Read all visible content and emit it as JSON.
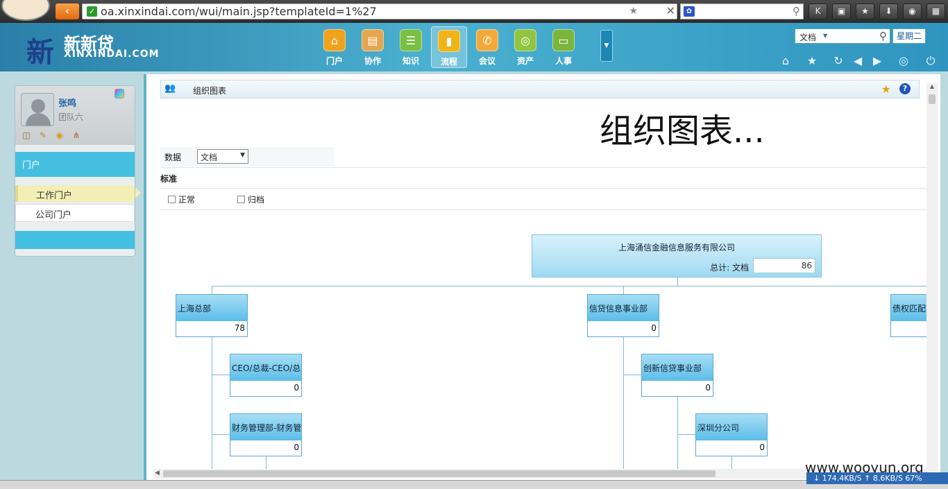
{
  "browser": {
    "url": "oa.xinxindai.com/wui/main.jsp?templateId=1%27",
    "back_glyph": "‹",
    "check_glyph": "✓",
    "star_glyph": "★",
    "close_glyph": "✕",
    "search_glyph": "⚲",
    "engine_glyph": "✿",
    "toolbar": [
      {
        "name": "k-button",
        "glyph": "K"
      },
      {
        "name": "lock-icon",
        "glyph": "▣"
      },
      {
        "name": "star-icon",
        "glyph": "★"
      },
      {
        "name": "download-icon",
        "glyph": "⬇"
      },
      {
        "name": "gamepad-icon",
        "glyph": "◉"
      },
      {
        "name": "grid-icon",
        "glyph": "▦"
      }
    ]
  },
  "header": {
    "logo_mark": "新",
    "logo_cn": "新新贷",
    "logo_en": "XINXINDAI.COM",
    "nav": [
      {
        "label": "门户",
        "icon": "home-icon",
        "glyph": "⌂",
        "color": "#f0a21c"
      },
      {
        "label": "协作",
        "icon": "clipboard-icon",
        "glyph": "▤",
        "color": "#e6a64f"
      },
      {
        "label": "知识",
        "icon": "database-icon",
        "glyph": "☰",
        "color": "#7bbf42"
      },
      {
        "label": "流程",
        "icon": "bar-chart-icon",
        "glyph": "▮",
        "color": "#f0b419"
      },
      {
        "label": "会议",
        "icon": "phone-icon",
        "glyph": "✆",
        "color": "#f2a93a"
      },
      {
        "label": "资产",
        "icon": "coins-icon",
        "glyph": "◎",
        "color": "#8fc63f"
      },
      {
        "label": "人事",
        "icon": "window-icon",
        "glyph": "▭",
        "color": "#7ab63b"
      }
    ],
    "active_nav": "流程",
    "search_type": "文档",
    "weekday": "星期二",
    "tools": [
      {
        "name": "home-tool-icon",
        "glyph": "⌂"
      },
      {
        "name": "favorite-tool-icon",
        "glyph": "★"
      },
      {
        "name": "refresh-tool-icon",
        "glyph": "↻"
      },
      {
        "name": "back-tool-icon",
        "glyph": "◀"
      },
      {
        "name": "forward-tool-icon",
        "glyph": "▶"
      },
      {
        "name": "settings-tool-icon",
        "glyph": "◎"
      },
      {
        "name": "power-tool-icon",
        "glyph": "⏻"
      }
    ]
  },
  "sidebar": {
    "user_name": "张鸣",
    "team": "团队六",
    "tools": [
      {
        "name": "book-icon",
        "glyph": "◫"
      },
      {
        "name": "note-icon",
        "glyph": "✎"
      },
      {
        "name": "lock-user-icon",
        "glyph": "◉"
      },
      {
        "name": "org-icon",
        "glyph": "⋔"
      }
    ],
    "section_title": "门户",
    "items": [
      {
        "label": "工作门户"
      },
      {
        "label": "公司门户"
      }
    ]
  },
  "main": {
    "title": "组织图表",
    "heading": "组织图表...",
    "data_label": "数据",
    "data_value": "文档",
    "standard_label": "标准",
    "checkboxes": [
      {
        "label": "正常"
      },
      {
        "label": "归档"
      }
    ],
    "fav_glyph": "★",
    "help_glyph": "?"
  },
  "org": {
    "root": {
      "name": "上海涌信金融信息服务有限公司",
      "total_label": "总计: 文档",
      "total": "86"
    },
    "nodes": [
      {
        "name": "上海总部",
        "value": "78"
      },
      {
        "name": "信贷信息事业部",
        "value": "0"
      },
      {
        "name": "债权匹配事",
        "value": ""
      },
      {
        "name": "CEO/总裁-CEO/总裁",
        "value": "0"
      },
      {
        "name": "财务管理部-财务管...",
        "value": "0"
      },
      {
        "name": "创新信贷事业部",
        "value": "0"
      },
      {
        "name": "深圳分公司",
        "value": "0"
      }
    ]
  },
  "status": {
    "speed": "↓ 174.4KB/S ↑ 8.6KB/S",
    "zoom": "67%",
    "watermark": "www.wooyun.org"
  }
}
